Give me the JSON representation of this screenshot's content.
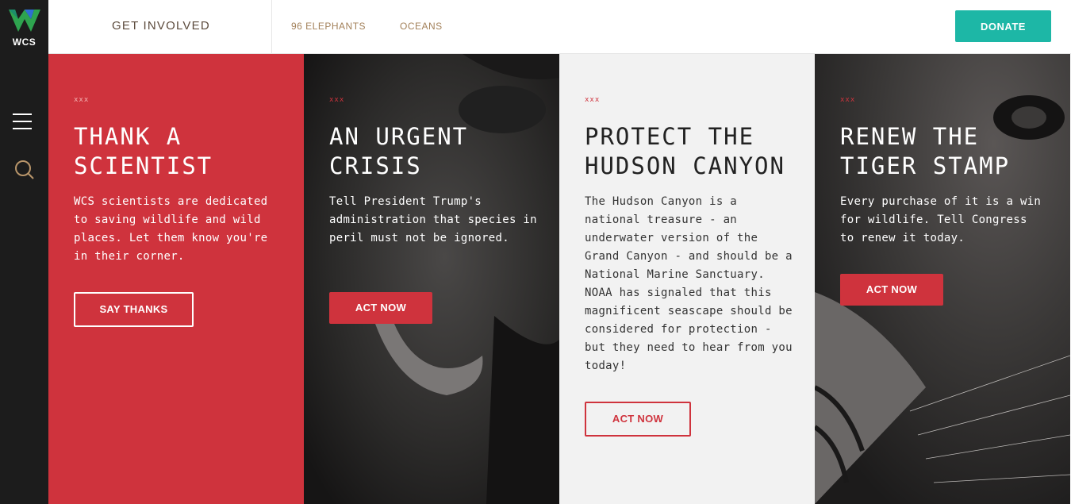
{
  "logo": {
    "text": "WCS"
  },
  "header": {
    "title": "GET INVOLVED",
    "links": [
      "96 ELEPHANTS",
      "OCEANS"
    ],
    "donate_label": "DONATE"
  },
  "panels": [
    {
      "dots": "xxx",
      "title": "THANK A SCIENTIST",
      "body": "WCS scientists are dedicated to saving wildlife and wild places. Let them know you're in their corner.",
      "button": "SAY THANKS"
    },
    {
      "dots": "xxx",
      "title": "AN URGENT CRISIS",
      "body": "Tell President Trump's administration that species in peril must not be ignored.",
      "button": "ACT NOW"
    },
    {
      "dots": "xxx",
      "title": "PROTECT THE HUDSON CANYON",
      "body": "The Hudson Canyon is a national treasure - an underwater version of the Grand Canyon - and should be a National Marine Sanctuary. NOAA has signaled that this magnificent seascape should be considered for protection - but they need to hear from you today!",
      "button": "ACT NOW"
    },
    {
      "dots": "xxx",
      "title": "RENEW THE TIGER STAMP",
      "body": "Every purchase of it is a win for wildlife. Tell Congress to renew it today.",
      "button": "ACT NOW"
    }
  ],
  "colors": {
    "accent_red": "#cf333d",
    "donate_teal": "#1db7a6",
    "nav_gold": "#a3815a",
    "rail_dark": "#1c1c1c"
  },
  "icons": [
    "wcs-logo-icon",
    "hamburger-menu-icon",
    "search-icon"
  ]
}
